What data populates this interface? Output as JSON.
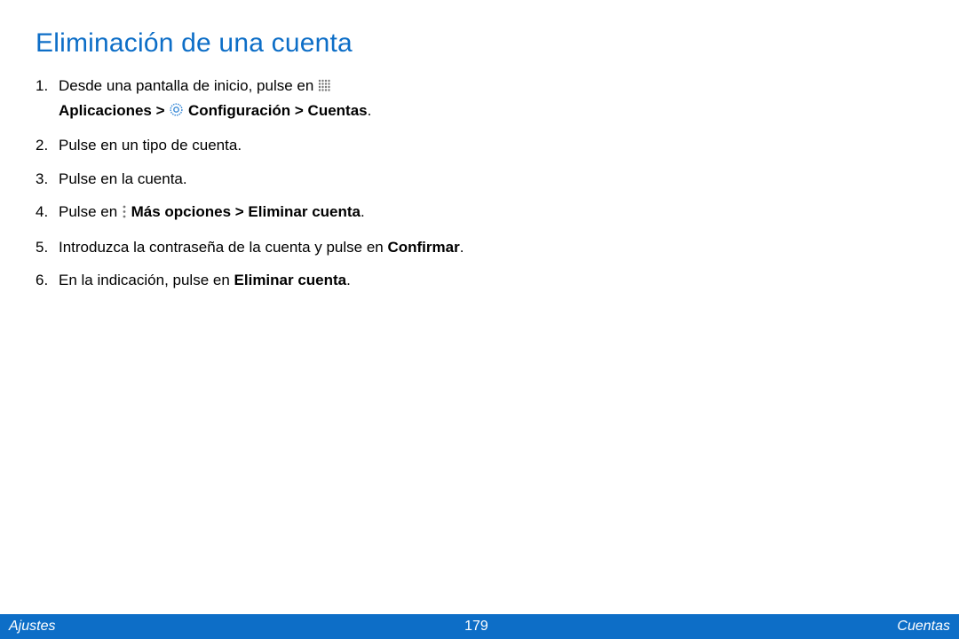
{
  "title": "Eliminación de una cuenta",
  "steps": {
    "s1": {
      "prefix": "Desde una pantalla de inicio, pulse en ",
      "bold1": "Aplicaciones > ",
      "bold2": " Configuración > Cuentas",
      "suffix": "."
    },
    "s2": "Pulse en un tipo de cuenta.",
    "s3": "Pulse en la cuenta.",
    "s4": {
      "prefix": "Pulse en ",
      "bold": " Más opciones > Eliminar cuenta",
      "suffix": "."
    },
    "s5": {
      "prefix": "Introduzca la contraseña de la cuenta y pulse en ",
      "bold": "Confirmar",
      "suffix": "."
    },
    "s6": {
      "prefix": "En la indicación, pulse en ",
      "bold": "Eliminar cuenta",
      "suffix": "."
    }
  },
  "footer": {
    "left": "Ajustes",
    "center": "179",
    "right": "Cuentas"
  },
  "icons": {
    "apps": "apps-grid-icon",
    "settings": "settings-gear-icon",
    "more": "more-options-icon"
  }
}
